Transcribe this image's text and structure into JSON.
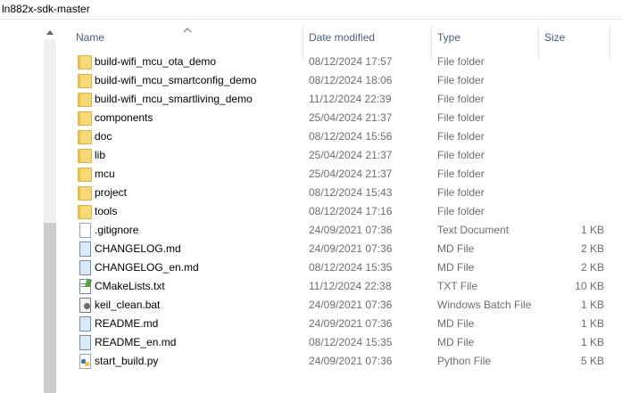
{
  "window": {
    "title": "ln882x-sdk-master"
  },
  "columns": {
    "name": "Name",
    "date": "Date modified",
    "type": "Type",
    "size": "Size"
  },
  "files": [
    {
      "name": "build-wifi_mcu_ota_demo",
      "date": "08/12/2024 17:57",
      "type": "File folder",
      "size": "",
      "icon": "folder-icon"
    },
    {
      "name": "build-wifi_mcu_smartconfig_demo",
      "date": "08/12/2024 18:06",
      "type": "File folder",
      "size": "",
      "icon": "folder-icon"
    },
    {
      "name": "build-wifi_mcu_smartliving_demo",
      "date": "11/12/2024 22:39",
      "type": "File folder",
      "size": "",
      "icon": "folder-icon"
    },
    {
      "name": "components",
      "date": "25/04/2024 21:37",
      "type": "File folder",
      "size": "",
      "icon": "folder-icon"
    },
    {
      "name": "doc",
      "date": "08/12/2024 15:56",
      "type": "File folder",
      "size": "",
      "icon": "folder-icon"
    },
    {
      "name": "lib",
      "date": "25/04/2024 21:37",
      "type": "File folder",
      "size": "",
      "icon": "folder-icon"
    },
    {
      "name": "mcu",
      "date": "25/04/2024 21:37",
      "type": "File folder",
      "size": "",
      "icon": "folder-icon"
    },
    {
      "name": "project",
      "date": "08/12/2024 15:43",
      "type": "File folder",
      "size": "",
      "icon": "folder-icon"
    },
    {
      "name": "tools",
      "date": "08/12/2024 17:16",
      "type": "File folder",
      "size": "",
      "icon": "folder-icon"
    },
    {
      "name": ".gitignore",
      "date": "24/09/2021 07:36",
      "type": "Text Document",
      "size": "1 KB",
      "icon": "text-file-icon"
    },
    {
      "name": "CHANGELOG.md",
      "date": "24/09/2021 07:36",
      "type": "MD File",
      "size": "2 KB",
      "icon": "md-file-icon"
    },
    {
      "name": "CHANGELOG_en.md",
      "date": "08/12/2024 15:35",
      "type": "MD File",
      "size": "2 KB",
      "icon": "md-file-icon"
    },
    {
      "name": "CMakeLists.txt",
      "date": "11/12/2024 22:38",
      "type": "TXT File",
      "size": "10 KB",
      "icon": "txt-file-icon"
    },
    {
      "name": "keil_clean.bat",
      "date": "24/09/2021 07:36",
      "type": "Windows Batch File",
      "size": "1 KB",
      "icon": "batch-file-icon"
    },
    {
      "name": "README.md",
      "date": "24/09/2021 07:36",
      "type": "MD File",
      "size": "1 KB",
      "icon": "md-file-icon"
    },
    {
      "name": "README_en.md",
      "date": "08/12/2024 15:35",
      "type": "MD File",
      "size": "1 KB",
      "icon": "md-file-icon"
    },
    {
      "name": "start_build.py",
      "date": "24/09/2021 07:36",
      "type": "Python File",
      "size": "5 KB",
      "icon": "python-file-icon"
    }
  ]
}
